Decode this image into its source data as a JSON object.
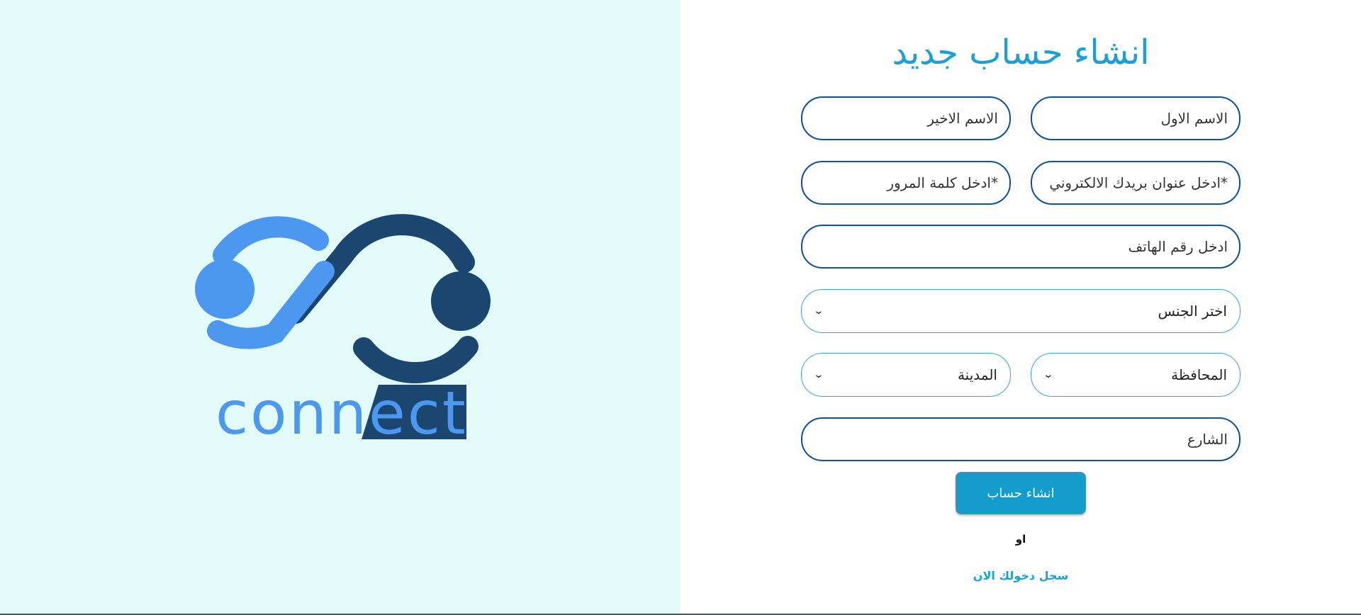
{
  "brand": {
    "logo_text_plain": "conn",
    "logo_text_highlight": "ect"
  },
  "colors": {
    "accent": "#1a9fd6",
    "left_background": "#e2fbf9",
    "logo_light_blue": "#4c97f0",
    "logo_dark_blue": "#1b4670",
    "field_border": "#0f4f9c",
    "button_background": "#139ccc"
  },
  "form": {
    "title": "انشاء حساب جديد",
    "first_name": {
      "placeholder": "الاسم الاول"
    },
    "last_name": {
      "placeholder": "الاسم الاخير"
    },
    "email": {
      "placeholder": "*ادخل عنوان بريدك الالكتروني"
    },
    "password": {
      "placeholder": "*ادخل كلمة المرور"
    },
    "phone": {
      "placeholder": "ادخل رقم الهاتف"
    },
    "gender": {
      "selected": "اختر الجنس",
      "icon": "chevron-down-icon"
    },
    "governorate": {
      "selected": "المحافظة",
      "icon": "chevron-down-icon"
    },
    "city": {
      "selected": "المدينة",
      "icon": "chevron-down-icon"
    },
    "street": {
      "placeholder": "الشارع"
    },
    "submit_label": "انشاء حساب",
    "or_text": "او",
    "login_link": "سجل دخولك الان"
  }
}
